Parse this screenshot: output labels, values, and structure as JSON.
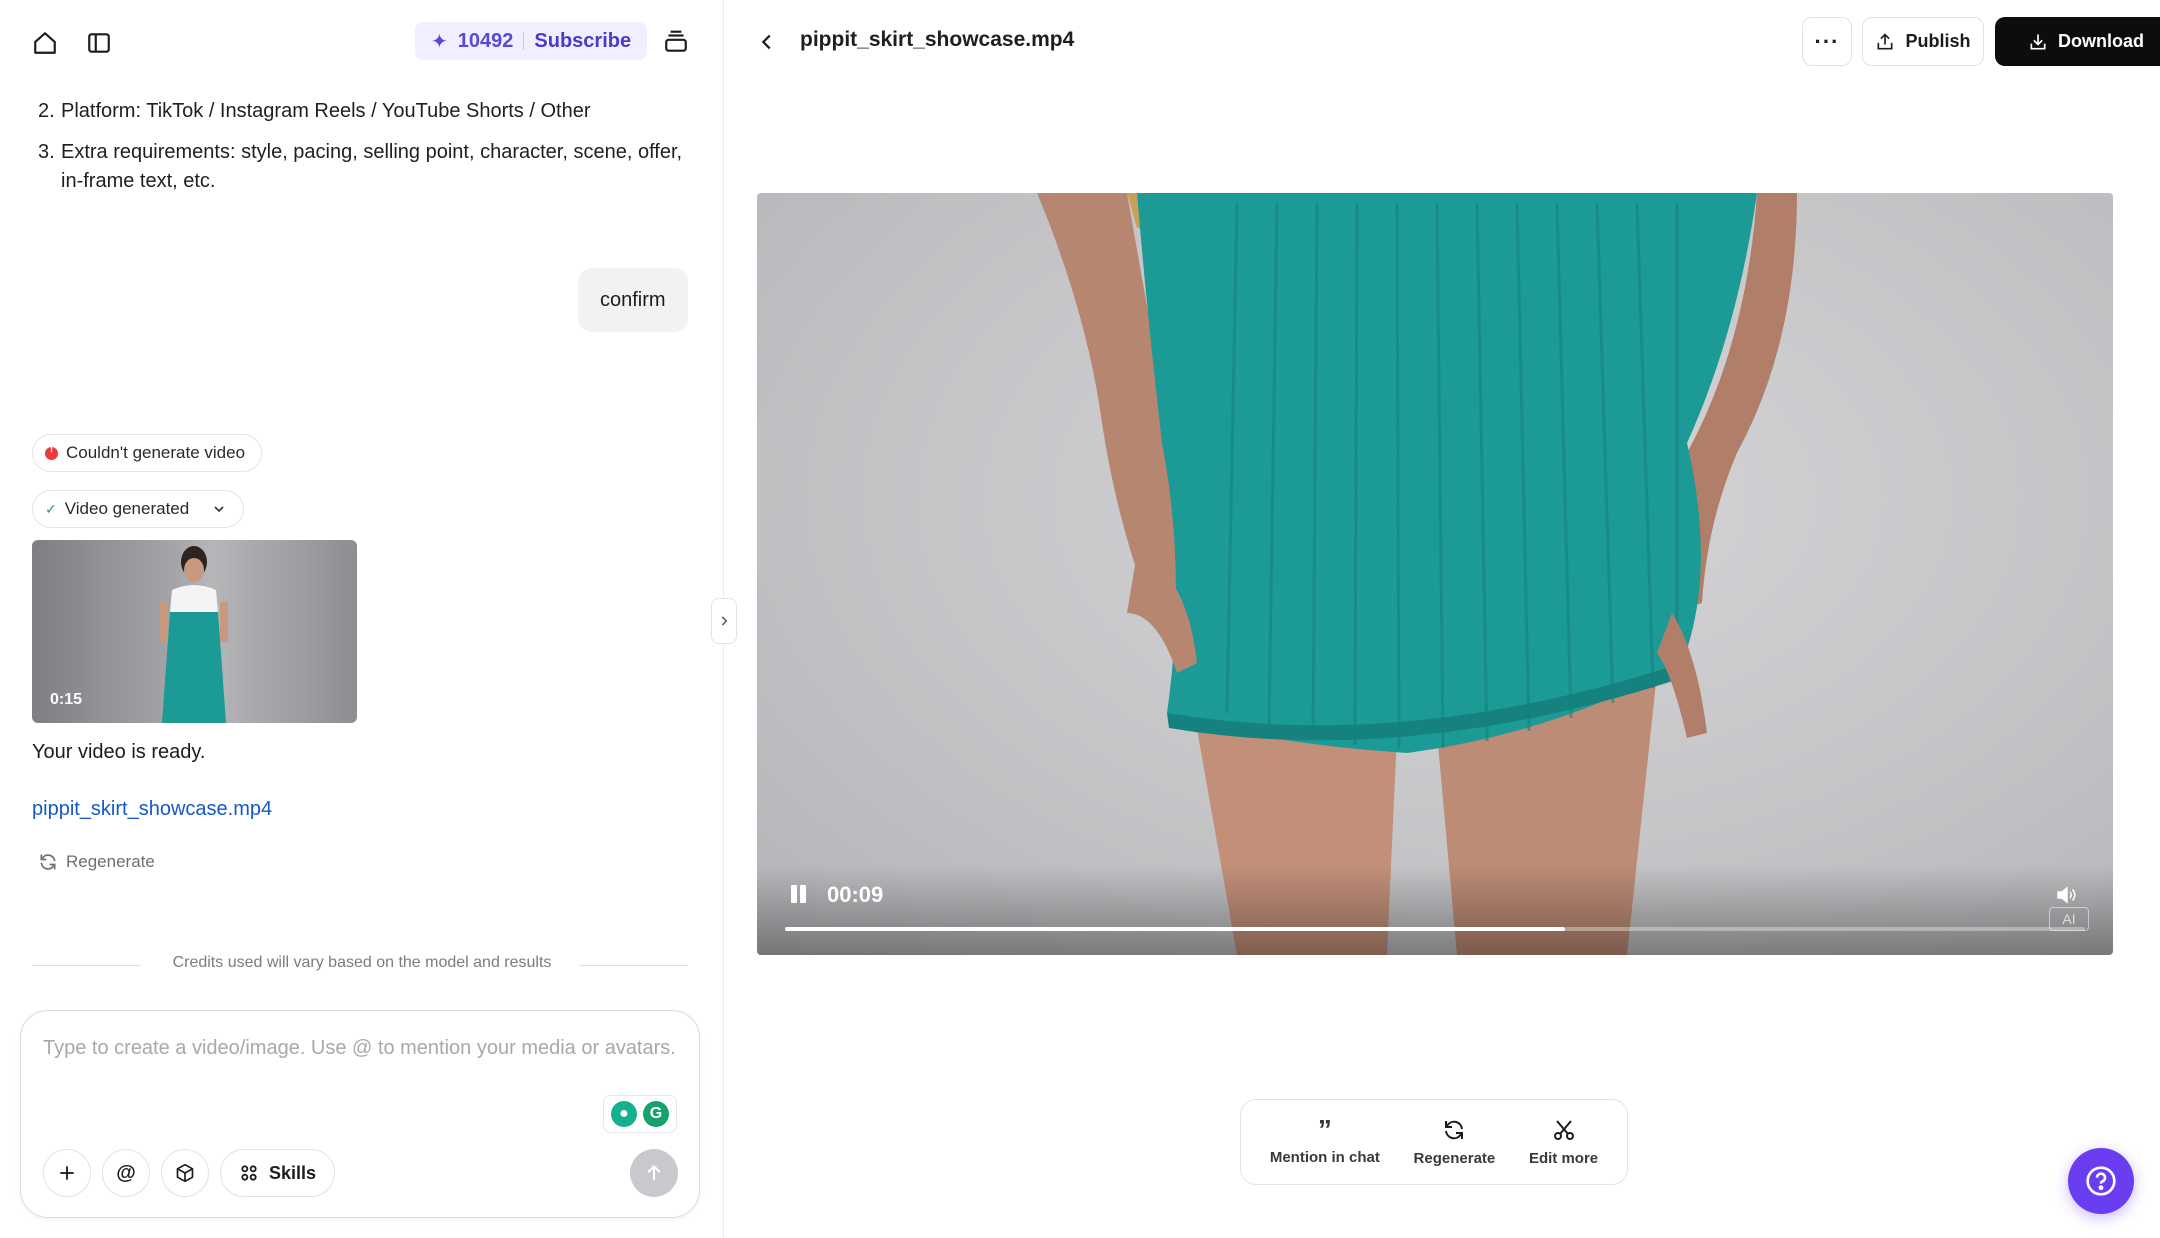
{
  "sidebar_header": {
    "credits": "10492",
    "subscribe_label": "Subscribe"
  },
  "chat": {
    "list_items": [
      {
        "num": "2.",
        "text": "Platform: TikTok / Instagram Reels / YouTube Shorts / Other"
      },
      {
        "num": "3.",
        "text": "Extra requirements: style, pacing, selling point, character, scene, offer, in-frame text, etc."
      }
    ],
    "user_message": "confirm",
    "error_chip": "Couldn't generate video",
    "success_chip": "Video generated",
    "thumbnail_duration": "0:15",
    "ready_text": "Your video is ready.",
    "file_link": "pippit_skirt_showcase.mp4",
    "regenerate_label": "Regenerate"
  },
  "credits_note": "Credits used will vary based on the model and results",
  "composer": {
    "placeholder": "Type to create a video/image. Use @ to mention your media or avatars.",
    "skills_label": "Skills"
  },
  "preview": {
    "file_title": "pippit_skirt_showcase.mp4",
    "publish_label": "Publish",
    "download_label": "Download",
    "current_time": "00:09",
    "progress_fraction": 0.6,
    "ai_badge": "AI"
  },
  "actions": {
    "mention_label": "Mention in chat",
    "regenerate_label": "Regenerate",
    "edit_label": "Edit more"
  },
  "colors": {
    "accent": "#6a3df0",
    "link": "#1559c7",
    "error": "#ec3b3b",
    "success": "#17a34a",
    "dress": "#1b9a96"
  }
}
